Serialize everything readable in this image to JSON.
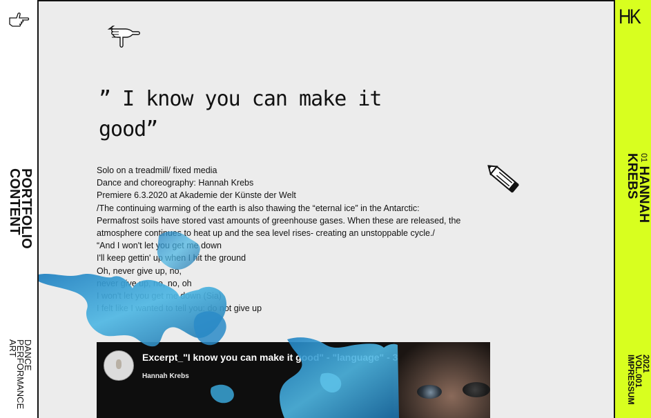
{
  "left_nav": {
    "section_line1": "PORTFOLIO",
    "section_line2": "CONTENT",
    "category_line1": "DANCE",
    "category_line2": "PERFORMANCE",
    "category_line3": "ART"
  },
  "right_nav": {
    "logo": "HK",
    "artist_number": "01",
    "artist_first": "HANNAH",
    "artist_last": "KREBS",
    "year": "2021",
    "volume": "VOL.001",
    "impressum": "IMPRESSUM",
    "accent_color": "#d8ff1f"
  },
  "work": {
    "quote_line1": "” I know you can make it",
    "quote_line2": "good”",
    "lines": [
      "Solo on a treadmill/ fixed media",
      "Dance and choreography: Hannah Krebs",
      "Premiere 6.3.2020 at Akademie der Künste der Welt",
      "/The continuing warming of the earth is also thawing the “eternal ice” in the Antarctic:",
      "Permafrost soils have stored vast amounts of greenhouse gases. When these are released, the",
      "atmosphere continues to heat up and the sea level rises- creating an unstoppable cycle./",
      "“And I won't let you get me down",
      "I'll keep gettin' up when I hit the ground",
      "Oh, never give up, no,",
      "never give up, no, no, oh",
      "I won't let you get me down (Sia)",
      "I felt like I wanted to tell you: do not give up"
    ]
  },
  "video": {
    "title": "Excerpt_\"I know you can make it good\" - \"language\" - 3",
    "author": "Hannah Krebs"
  },
  "icons": {
    "top_left": "pointing-hand-icon",
    "quote_icon": "pointing-down-hand-icon",
    "pencil": "pencil-icon",
    "paint_splash": "blue-paint-splash"
  }
}
